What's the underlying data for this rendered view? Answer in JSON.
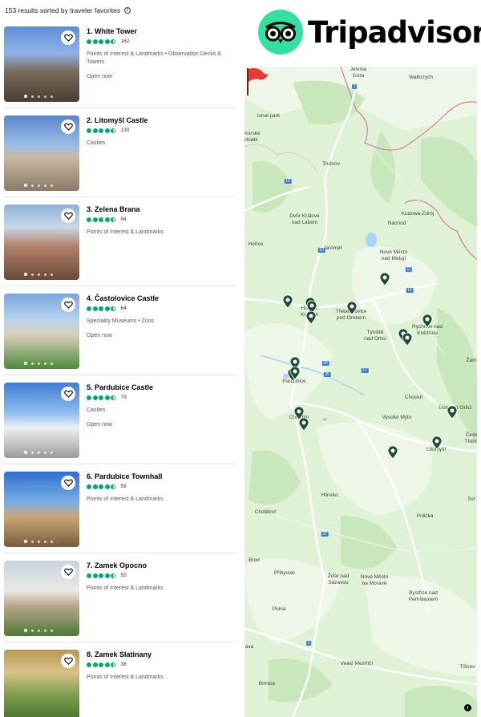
{
  "header": {
    "results_text": "153 results sorted by traveler favorites",
    "info_icon": "info-icon"
  },
  "brand": {
    "name": "Tripadvisor",
    "logo_icon": "owl-eyes-icon",
    "color": "#34e0a1"
  },
  "colors": {
    "rating_bubble": "#00aa6c",
    "pin": "#1f4d3a",
    "flag": "#e23b3b"
  },
  "listings": [
    {
      "title": "1. White Tower",
      "rating": 4.5,
      "reviews": "162",
      "category": "Points of Interest & Landmarks • Observation Decks & Towers",
      "status": "Open now"
    },
    {
      "title": "2. Litomyšl Castle",
      "rating": 4.5,
      "reviews": "130",
      "category": "Castles",
      "status": ""
    },
    {
      "title": "3. Zelena Brana",
      "rating": 4.5,
      "reviews": "94",
      "category": "Points of Interest & Landmarks",
      "status": ""
    },
    {
      "title": "4. Častolovice Castle",
      "rating": 4.5,
      "reviews": "64",
      "category": "Speciality Museums • Zoos",
      "status": "Open now"
    },
    {
      "title": "5. Pardubice Castle",
      "rating": 4.5,
      "reviews": "79",
      "category": "Castles",
      "status": "Open now"
    },
    {
      "title": "6. Pardubice Townhall",
      "rating": 4.5,
      "reviews": "59",
      "category": "Points of Interest & Landmarks",
      "status": ""
    },
    {
      "title": "7. Zamek Opocno",
      "rating": 4.5,
      "reviews": "55",
      "category": "Points of Interest & Landmarks",
      "status": ""
    },
    {
      "title": "8. Zamek Slatinany",
      "rating": 4.5,
      "reviews": "38",
      "category": "Points of Interest & Landmarks",
      "status": ""
    }
  ],
  "map": {
    "places": [
      {
        "name": "Jelenia\nGóra"
      },
      {
        "name": "Wałbrzych"
      },
      {
        "name": "onorské\nchiabi"
      },
      {
        "name": "Trutnov"
      },
      {
        "name": "Dvůr Králové\nnad Labem"
      },
      {
        "name": "Kudowa-Zdrój"
      },
      {
        "name": "Náchod"
      },
      {
        "name": "Hořice"
      },
      {
        "name": "Jaroměř"
      },
      {
        "name": "Nové Město\nnad Metují"
      },
      {
        "name": "Hradec\nKrálové"
      },
      {
        "name": "Třebechovice\npod Orebem"
      },
      {
        "name": "Týniště\nnad Orlicí"
      },
      {
        "name": "Rychnov nad\nKněžnou"
      },
      {
        "name": "Žam"
      },
      {
        "name": "Pardubice"
      },
      {
        "name": "Choceň"
      },
      {
        "name": "Chrudim"
      },
      {
        "name": "Vysoké Mýto"
      },
      {
        "name": "Ústí nad Orlicí"
      },
      {
        "name": "Česk\nTřebo"
      },
      {
        "name": "Litomyšl"
      },
      {
        "name": "Hlinsko"
      },
      {
        "name": "Sví"
      },
      {
        "name": "Chotěboř"
      },
      {
        "name": "Polička"
      },
      {
        "name": "Brod"
      },
      {
        "name": "Přibyslav"
      },
      {
        "name": "Žďár nad\nSázavou"
      },
      {
        "name": "Nové Město\nna Moravě"
      },
      {
        "name": "Bystřice nad\nPernštejnem"
      },
      {
        "name": "Polná"
      },
      {
        "name": "ava"
      },
      {
        "name": "Velké Meziříčí"
      },
      {
        "name": "Tišnov"
      },
      {
        "name": "Brtnice"
      },
      {
        "name": "ional park"
      }
    ],
    "routes": [
      "3",
      "16",
      "10",
      "11",
      "35",
      "14",
      "17",
      "35",
      "37",
      "1"
    ],
    "pin_icon": "attraction-pin-icon",
    "flag_icon": "location-flag-icon",
    "map_info_icon": "info-icon"
  }
}
